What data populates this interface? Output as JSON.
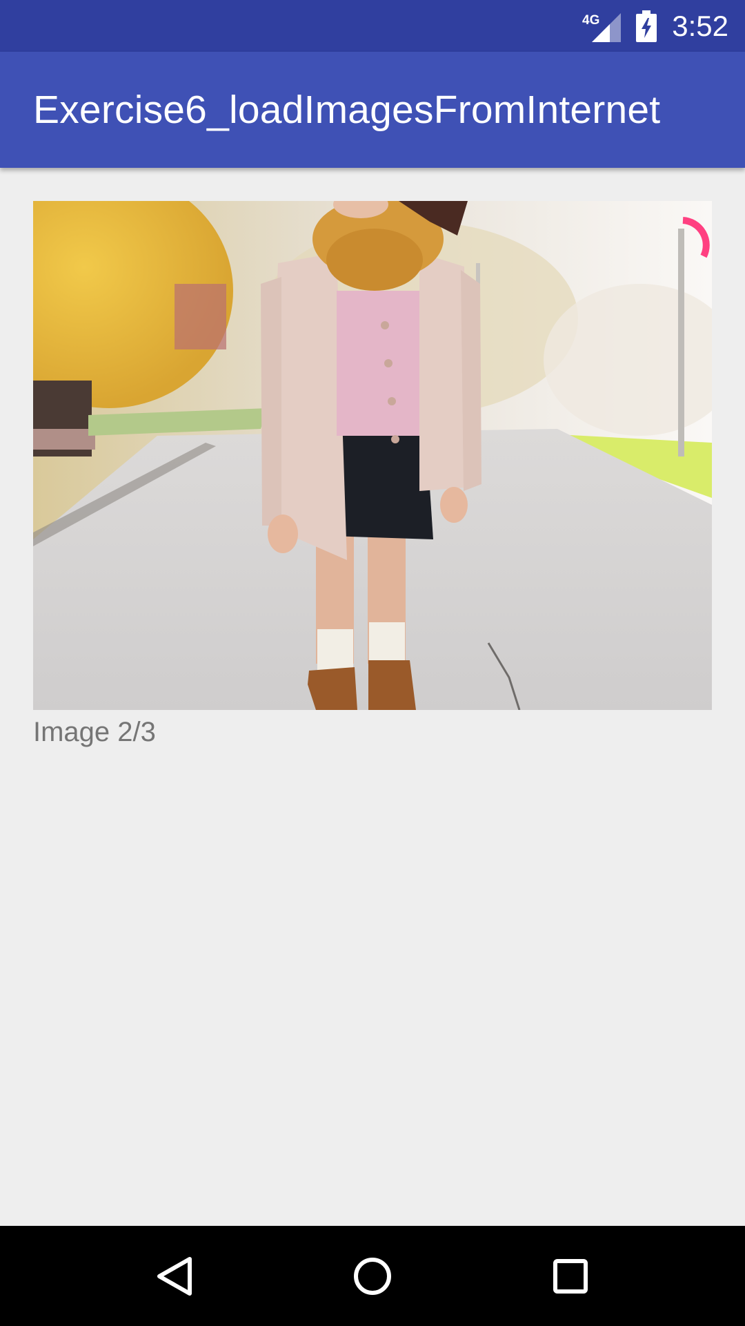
{
  "status_bar": {
    "network_label": "4G",
    "time": "3:52",
    "icons": [
      "signal-4g-icon",
      "battery-charging-icon"
    ]
  },
  "app_bar": {
    "title": "Exercise6_loadImagesFromInternet"
  },
  "content": {
    "image_caption": "Image 2/3",
    "loading_indicator_color": "#ff4081"
  },
  "nav_bar": {
    "buttons": [
      "back-icon",
      "home-icon",
      "recents-icon"
    ]
  },
  "colors": {
    "status_bar": "#303f9f",
    "app_bar": "#3f51b5",
    "background": "#eeeeee",
    "accent": "#ff4081"
  }
}
